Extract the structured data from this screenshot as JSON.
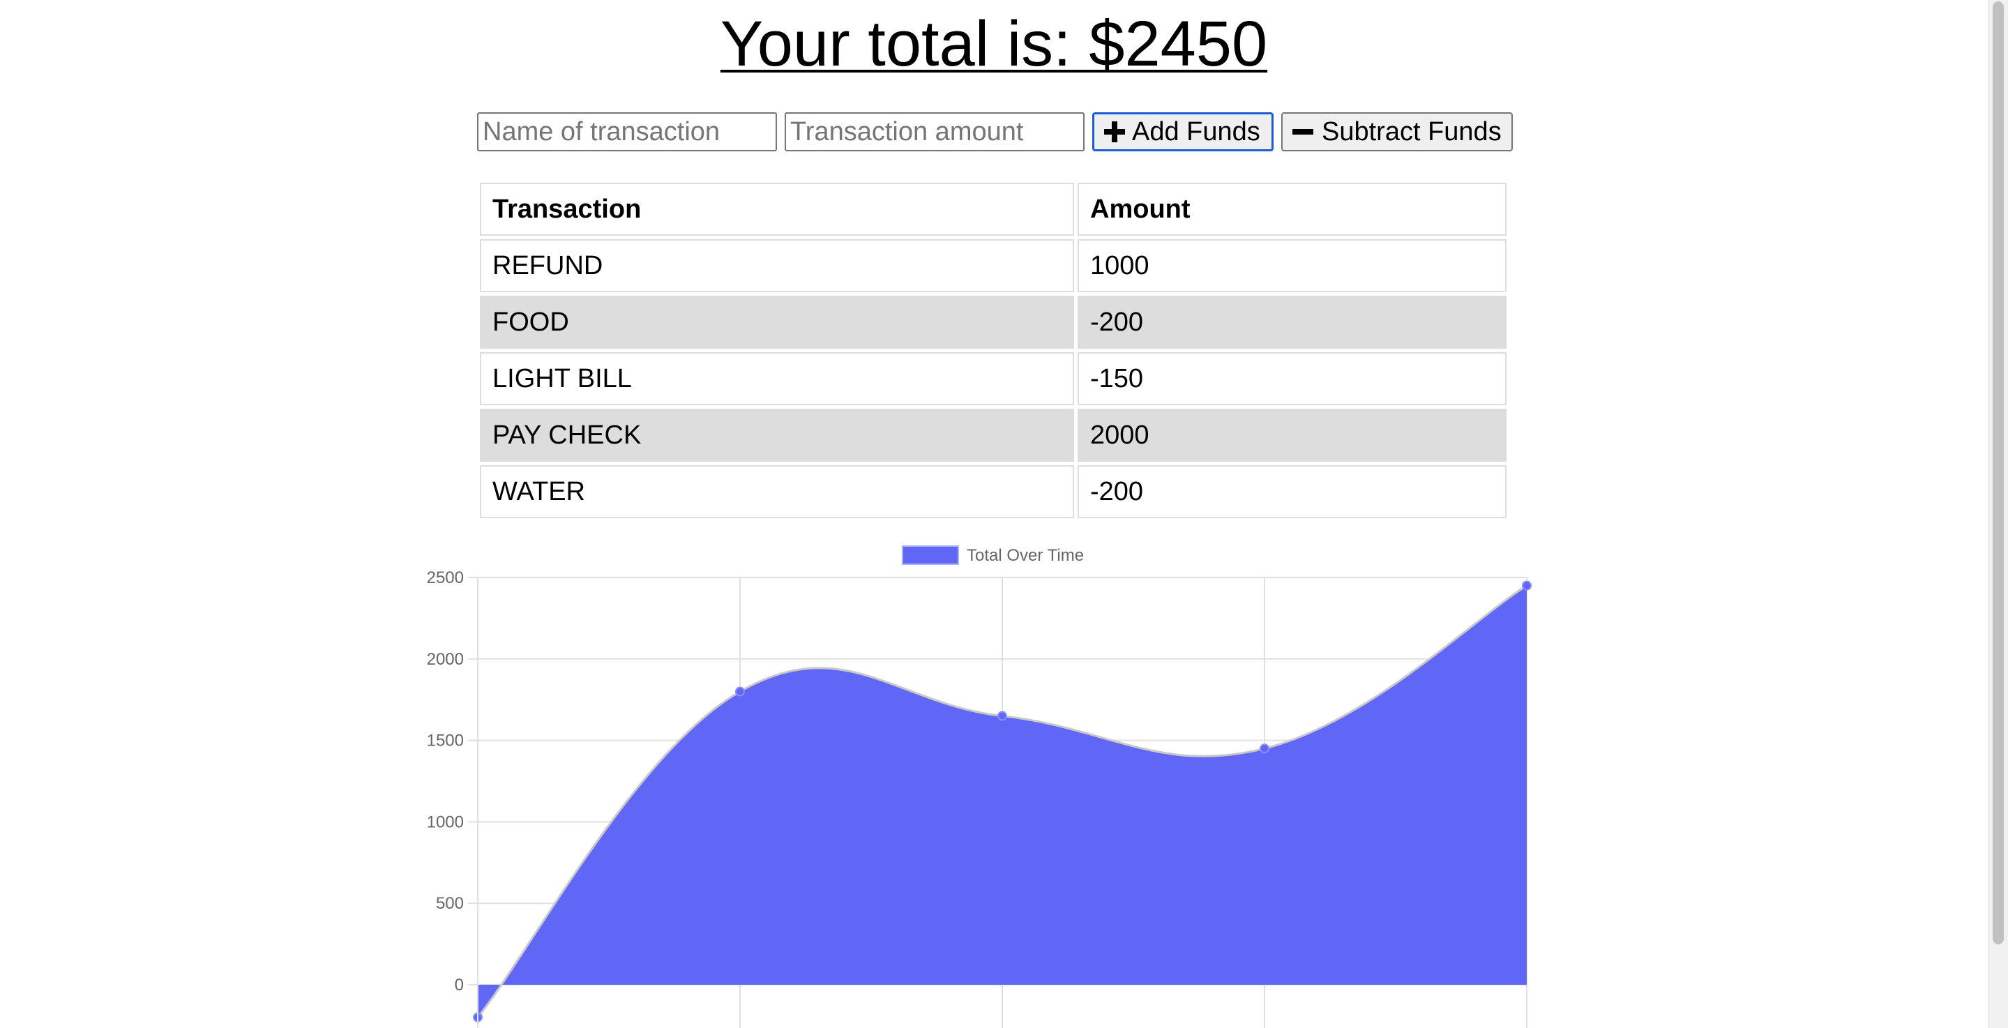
{
  "header": {
    "total_text": "Your total is: $2450"
  },
  "form": {
    "name_placeholder": "Name of transaction",
    "amount_placeholder": "Transaction amount",
    "add_label": "Add Funds",
    "subtract_label": "Subtract Funds"
  },
  "table": {
    "headers": [
      "Transaction",
      "Amount"
    ],
    "rows": [
      {
        "name": "REFUND",
        "amount": "1000"
      },
      {
        "name": "FOOD",
        "amount": "-200"
      },
      {
        "name": "LIGHT BILL",
        "amount": "-150"
      },
      {
        "name": "PAY CHECK",
        "amount": "2000"
      },
      {
        "name": "WATER",
        "amount": "-200"
      }
    ]
  },
  "chart_data": {
    "type": "area",
    "title": "",
    "xlabel": "",
    "ylabel": "",
    "ylim": [
      -200,
      2500
    ],
    "yticks": [
      0,
      500,
      1000,
      1500,
      2000,
      2500
    ],
    "grid": true,
    "legend_position": "top",
    "series": [
      {
        "name": "Total Over Time",
        "color": "#6066f5",
        "values": [
          -200,
          1800,
          1650,
          1450,
          2450
        ]
      }
    ]
  },
  "colors": {
    "accent_blue": "#1a5bd6",
    "row_shade": "#dddddd",
    "area_fill": "#6066f5"
  }
}
